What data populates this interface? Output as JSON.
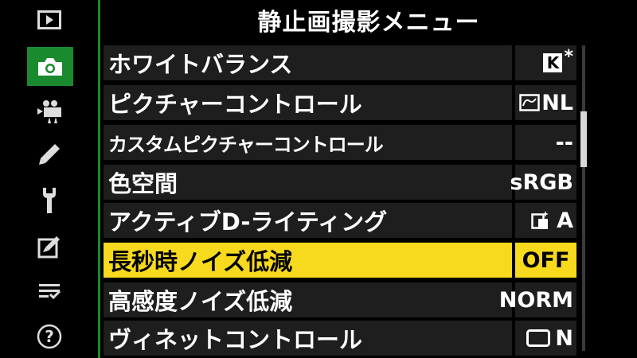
{
  "title": "静止画撮影メニュー",
  "tabs": [
    {
      "icon": "playback-icon"
    },
    {
      "icon": "camera-icon",
      "active": true
    },
    {
      "icon": "movie-camera-icon"
    },
    {
      "icon": "pencil-icon"
    },
    {
      "icon": "wrench-icon"
    },
    {
      "icon": "retouch-icon"
    },
    {
      "icon": "my-menu-icon"
    },
    {
      "icon": "help-icon"
    }
  ],
  "menu": {
    "rows": [
      {
        "label": "ホワイトバランス",
        "value_icon": "k-box-icon",
        "value": "*"
      },
      {
        "label": "ピクチャーコントロール",
        "value_icon": "picture-control-icon",
        "value": "NL"
      },
      {
        "label": "カスタムピクチャーコントロール",
        "value": "--"
      },
      {
        "label": "色空間",
        "value": "sRGB"
      },
      {
        "label": "アクティブD-ライティング",
        "value_icon": "adl-icon",
        "value": "A"
      },
      {
        "label": "長秒時ノイズ低減",
        "value": "OFF",
        "selected": true
      },
      {
        "label": "高感度ノイズ低減",
        "value": "NORM"
      },
      {
        "label": "ヴィネットコントロール",
        "value_icon": "vignette-icon",
        "value": "N"
      }
    ],
    "k_box_text": "K"
  },
  "colors": {
    "accent": "#1a8a2e",
    "selection": "#f7d91e",
    "row_bg": "#1e1e1e",
    "background": "#000000"
  },
  "scroll": {
    "position_fraction": 0.2
  }
}
